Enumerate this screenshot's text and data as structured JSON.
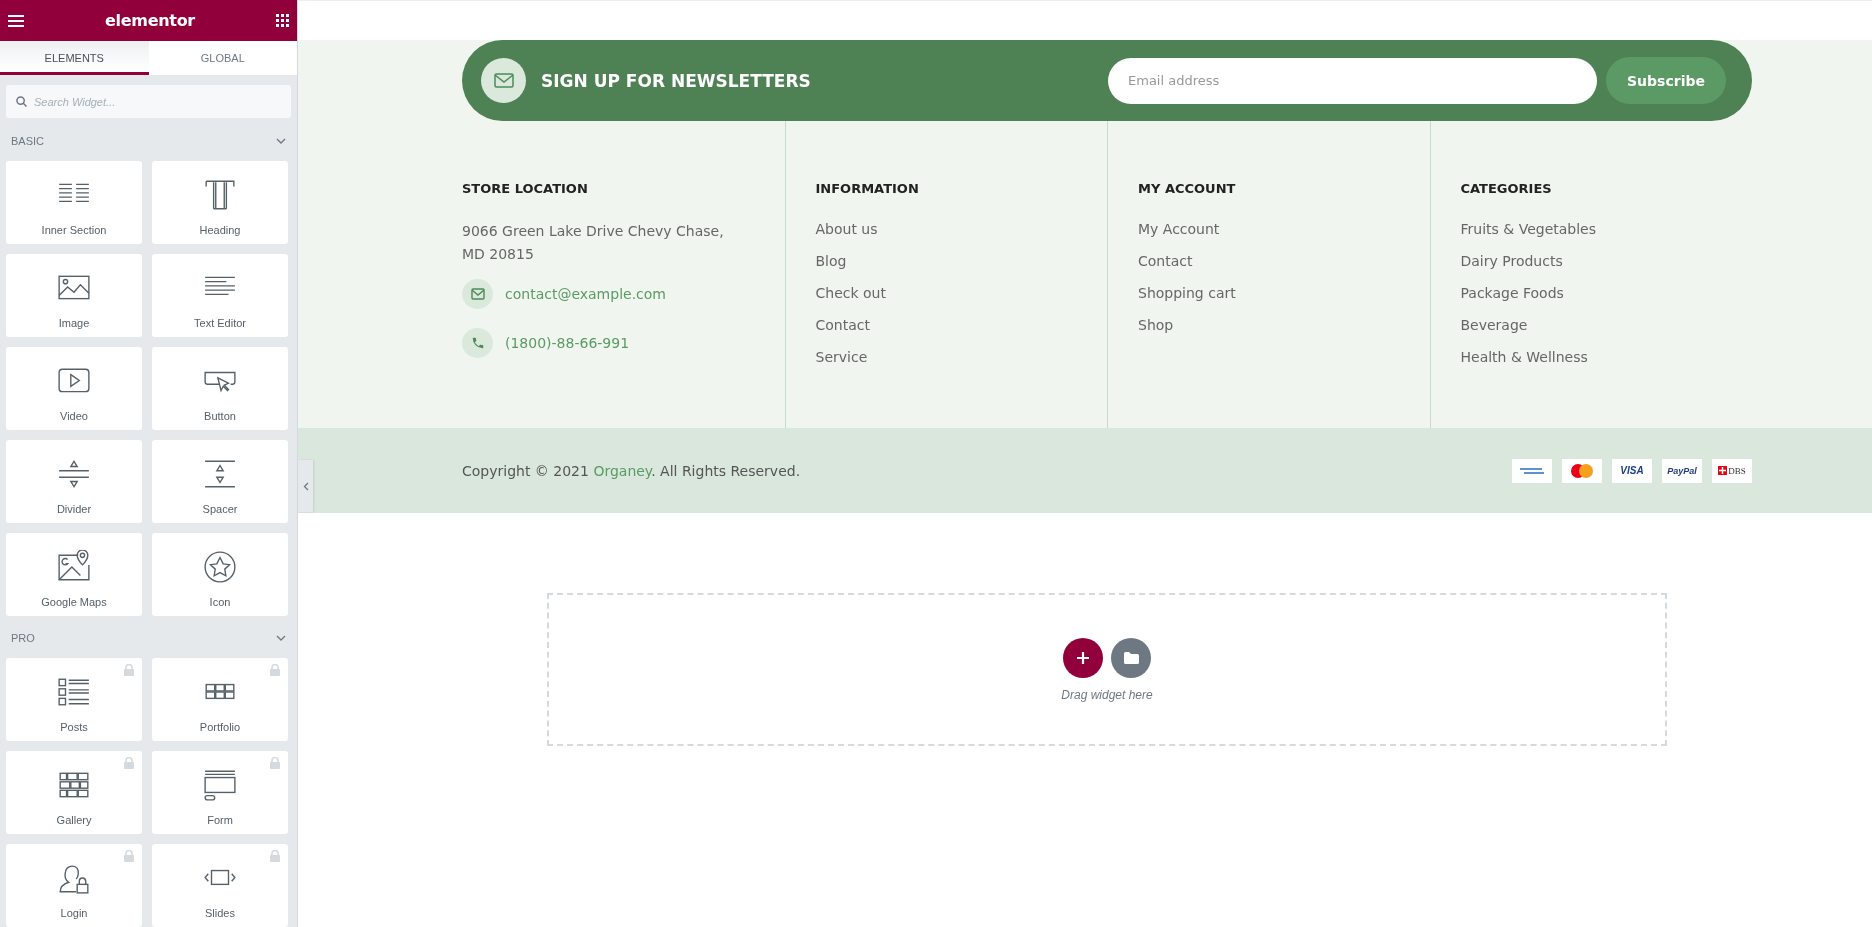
{
  "sidebar": {
    "brand": "elementor",
    "tabs": [
      {
        "label": "ELEMENTS",
        "selected": true
      },
      {
        "label": "GLOBAL",
        "selected": false
      }
    ],
    "search": {
      "placeholder": "Search Widget..."
    },
    "sections": [
      {
        "title": "BASIC",
        "expanded": true,
        "widgets": [
          {
            "label": "Inner Section",
            "kind": "columns",
            "locked": false
          },
          {
            "label": "Heading",
            "kind": "heading",
            "locked": false
          },
          {
            "label": "Image",
            "kind": "image",
            "locked": false
          },
          {
            "label": "Text Editor",
            "kind": "text",
            "locked": false
          },
          {
            "label": "Video",
            "kind": "video",
            "locked": false
          },
          {
            "label": "Button",
            "kind": "button",
            "locked": false
          },
          {
            "label": "Divider",
            "kind": "divider",
            "locked": false
          },
          {
            "label": "Spacer",
            "kind": "spacer",
            "locked": false
          },
          {
            "label": "Google Maps",
            "kind": "map",
            "locked": false
          },
          {
            "label": "Icon",
            "kind": "star",
            "locked": false
          }
        ]
      },
      {
        "title": "PRO",
        "expanded": true,
        "widgets": [
          {
            "label": "Posts",
            "kind": "posts",
            "locked": true
          },
          {
            "label": "Portfolio",
            "kind": "portfolio",
            "locked": true
          },
          {
            "label": "Gallery",
            "kind": "gallery",
            "locked": true
          },
          {
            "label": "Form",
            "kind": "form",
            "locked": true
          },
          {
            "label": "Login",
            "kind": "login",
            "locked": true
          },
          {
            "label": "Slides",
            "kind": "slides",
            "locked": true
          }
        ]
      }
    ]
  },
  "newsletter": {
    "title": "SIGN UP FOR NEWSLETTERS",
    "email": {
      "placeholder": "Email address"
    },
    "button": "Subscribe"
  },
  "footer": {
    "columns": [
      {
        "title": "STORE LOCATION",
        "address": "9066 Green Lake Drive Chevy Chase, MD 20815",
        "contacts": [
          {
            "kind": "email",
            "text": "contact@example.com"
          },
          {
            "kind": "phone",
            "text": "(1800)-88-66-991"
          }
        ]
      },
      {
        "title": "INFORMATION",
        "links": [
          "About us",
          "Blog",
          "Check out",
          "Contact",
          "Service"
        ]
      },
      {
        "title": "MY ACCOUNT",
        "links": [
          "My Account",
          "Contact",
          "Shopping cart",
          "Shop"
        ]
      },
      {
        "title": "CATEGORIES",
        "links": [
          "Fruits & Vegetables",
          "Dairy Products",
          "Package Foods",
          "Beverage",
          "Health & Wellness"
        ]
      }
    ]
  },
  "copyright": {
    "before": "Copyright © 2021 ",
    "brand": "Organey",
    "after": ". All Rights Reserved."
  },
  "payments": [
    {
      "kind": "amex"
    },
    {
      "kind": "mastercard"
    },
    {
      "kind": "visa",
      "text": "VISA"
    },
    {
      "kind": "paypal",
      "text": "PayPal"
    },
    {
      "kind": "dbs",
      "text": "DBS"
    }
  ],
  "dropzone": {
    "hint": "Drag widget here"
  }
}
